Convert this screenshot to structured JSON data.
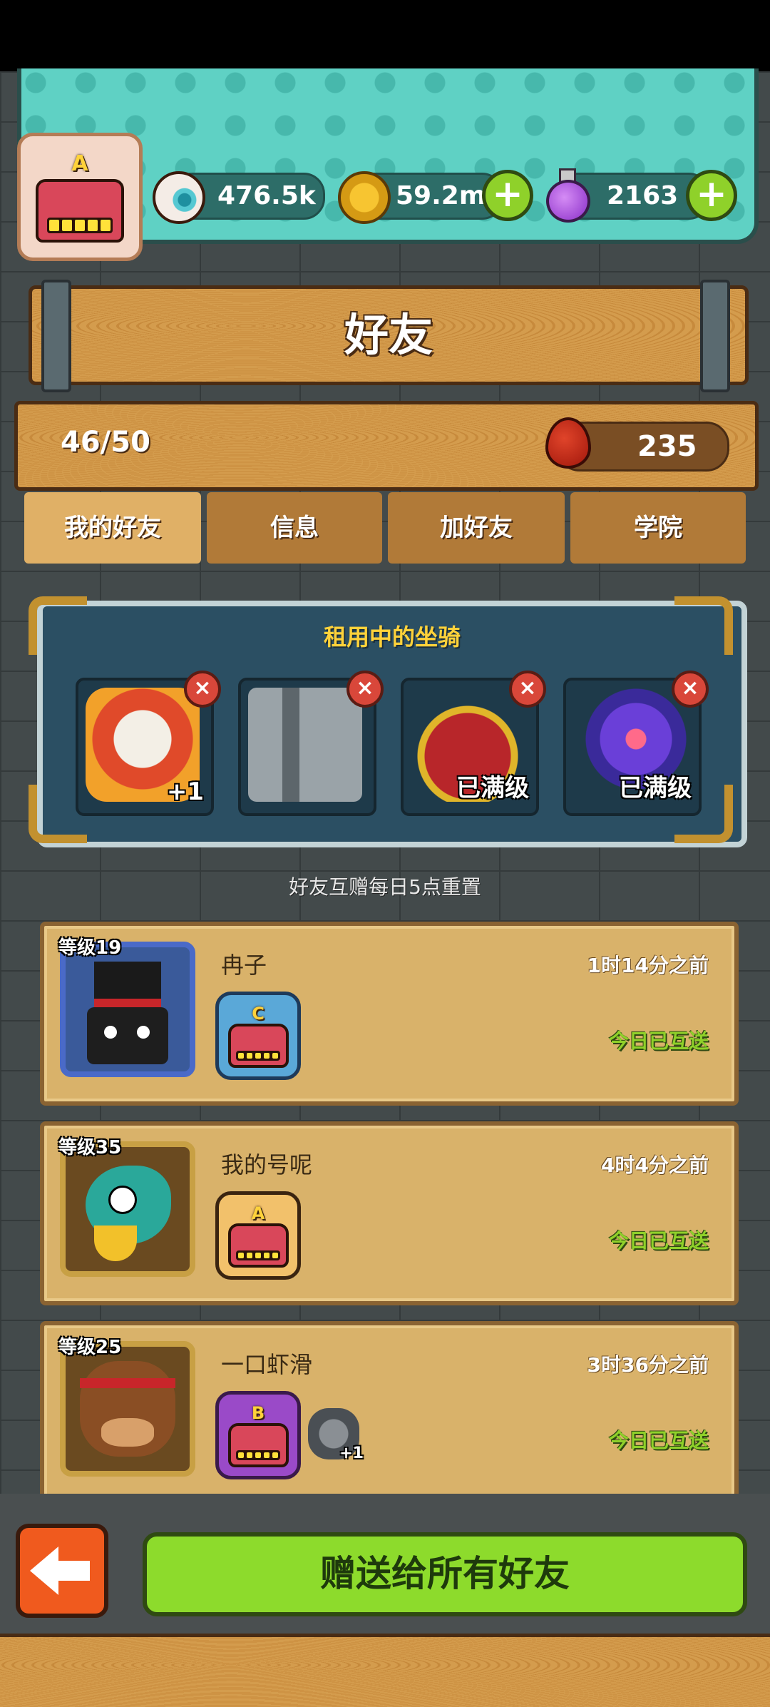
{
  "resources": {
    "eyeball": {
      "value": "476.5k",
      "icon": "eyeball-icon"
    },
    "coin": {
      "value": "59.2m",
      "icon": "coin-icon"
    },
    "potion": {
      "value": "2163",
      "icon": "potion-icon"
    }
  },
  "player_badge": {
    "grade": "A"
  },
  "page": {
    "title": "好友"
  },
  "friends_count": "46/50",
  "blood": {
    "value": "235",
    "icon": "blood-drop-icon"
  },
  "tabs": [
    {
      "label": "我的好友",
      "active": true
    },
    {
      "label": "信息",
      "active": false
    },
    {
      "label": "加好友",
      "active": false
    },
    {
      "label": "学院",
      "active": false
    }
  ],
  "mounts": {
    "title": "租用中的坐骑",
    "slots": [
      {
        "name": "lion-dance",
        "label": "+1"
      },
      {
        "name": "metal-machine",
        "label": ""
      },
      {
        "name": "red-demon",
        "label": "已满级"
      },
      {
        "name": "purple-rose",
        "label": "已满级"
      }
    ]
  },
  "reset_note": "好友互赠每日5点重置",
  "friends": [
    {
      "level": "等级19",
      "name": "冉子",
      "time": "1时14分之前",
      "grade": "C",
      "status": "今日已互送",
      "extra": ""
    },
    {
      "level": "等级35",
      "name": "我的号呢",
      "time": "4时4分之前",
      "grade": "A",
      "status": "今日已互送",
      "extra": ""
    },
    {
      "level": "等级25",
      "name": "一口虾滑",
      "time": "3时36分之前",
      "grade": "B",
      "status": "今日已互送",
      "extra": "+1"
    }
  ],
  "actions": {
    "send_all": "赠送给所有好友"
  },
  "colors": {
    "accent_green": "#8ddb2c",
    "teal": "#5fd1c4",
    "wood": "#cf9448"
  }
}
